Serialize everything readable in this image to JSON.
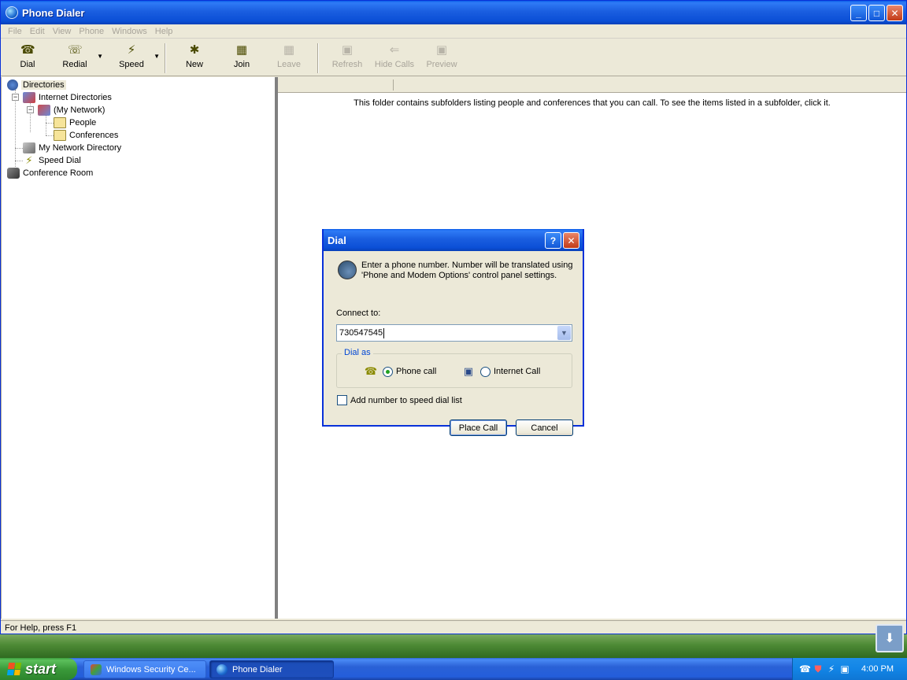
{
  "window": {
    "title": "Phone Dialer"
  },
  "menu": [
    "File",
    "Edit",
    "View",
    "Phone",
    "Windows",
    "Help"
  ],
  "toolbar": {
    "dial": "Dial",
    "redial": "Redial",
    "speed": "Speed",
    "new": "New",
    "join": "Join",
    "leave": "Leave",
    "refresh": "Refresh",
    "hide_calls": "Hide Calls",
    "preview": "Preview"
  },
  "tree": {
    "directories": "Directories",
    "internet_directories": "Internet Directories",
    "my_network": "(My Network)",
    "people": "People",
    "conferences": "Conferences",
    "my_network_directory": "My Network Directory",
    "speed_dial": "Speed Dial",
    "conference_room": "Conference Room"
  },
  "content": {
    "info": "This folder contains subfolders listing people and conferences that you can call. To see the items listed in a subfolder, click it."
  },
  "status": "For Help, press F1",
  "dialog": {
    "title": "Dial",
    "message": "Enter a phone number.  Number will be translated using 'Phone and Modem Options' control panel settings.",
    "connect_label": "Connect to:",
    "connect_value": "730547545",
    "dial_as": "Dial as",
    "phone_call": "Phone call",
    "internet_call": "Internet Call",
    "add_speed": "Add number to speed dial list",
    "place_call": "Place Call",
    "cancel": "Cancel",
    "selected": "phone"
  },
  "taskbar": {
    "start": "start",
    "tasks": [
      "Windows Security Ce...",
      "Phone Dialer"
    ],
    "clock": "4:00 PM"
  }
}
